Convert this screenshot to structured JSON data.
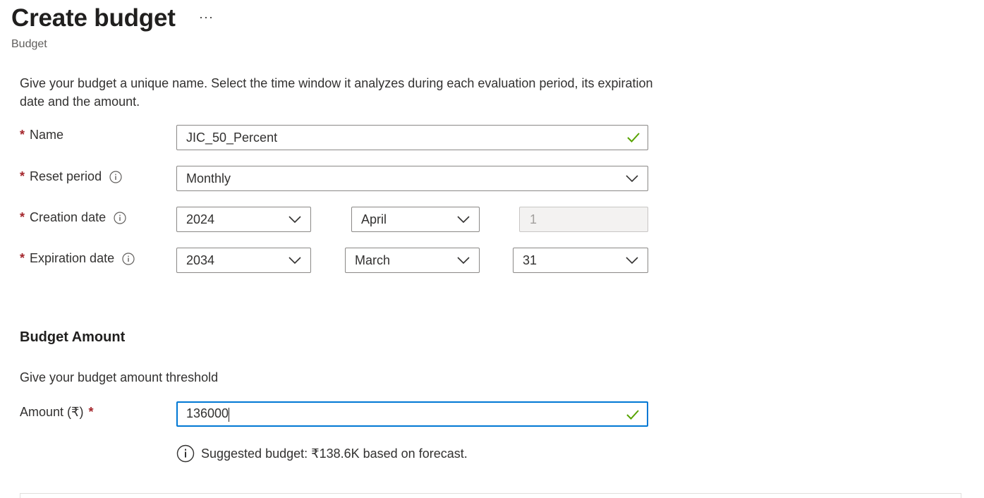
{
  "header": {
    "title": "Create budget",
    "more_label": "···",
    "subtitle": "Budget"
  },
  "intro": "Give your budget a unique name. Select the time window it analyzes during each evaluation period, its expiration date and the amount.",
  "form": {
    "name": {
      "label": "Name",
      "value": "JIC_50_Percent"
    },
    "reset_period": {
      "label": "Reset period",
      "value": "Monthly"
    },
    "creation_date": {
      "label": "Creation date",
      "year": "2024",
      "month": "April",
      "day": "1"
    },
    "expiration_date": {
      "label": "Expiration date",
      "year": "2034",
      "month": "March",
      "day": "31"
    }
  },
  "budget_amount": {
    "title": "Budget Amount",
    "description": "Give your budget amount threshold",
    "amount_label": "Amount (₹)",
    "amount_value": "136000",
    "suggestion": "Suggested budget: ₹138.6K based on forecast."
  },
  "required_marker": "*",
  "icons": {
    "info": "info-icon",
    "dropdown": "chevron-down-icon",
    "valid": "checkmark-icon"
  },
  "colors": {
    "required": "#a4262c",
    "focus": "#0078d4",
    "valid": "#57a300"
  }
}
